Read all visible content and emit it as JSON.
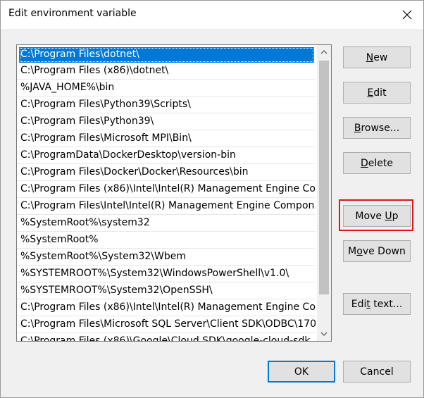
{
  "window": {
    "title": "Edit environment variable"
  },
  "list": {
    "selected_index": 0,
    "items": [
      "C:\\Program Files\\dotnet\\",
      "C:\\Program Files (x86)\\dotnet\\",
      "%JAVA_HOME%\\bin",
      "C:\\Program Files\\Python39\\Scripts\\",
      "C:\\Program Files\\Python39\\",
      "C:\\Program Files\\Microsoft MPI\\Bin\\",
      "C:\\ProgramData\\DockerDesktop\\version-bin",
      "C:\\Program Files\\Docker\\Docker\\Resources\\bin",
      "C:\\Program Files (x86)\\Intel\\Intel(R) Management Engine Co...",
      "C:\\Program Files\\Intel\\Intel(R) Management Engine Compon...",
      "%SystemRoot%\\system32",
      "%SystemRoot%",
      "%SystemRoot%\\System32\\Wbem",
      "%SYSTEMROOT%\\System32\\WindowsPowerShell\\v1.0\\",
      "%SYSTEMROOT%\\System32\\OpenSSH\\",
      "C:\\Program Files (x86)\\Intel\\Intel(R) Management Engine Co...",
      "C:\\Program Files\\Microsoft SQL Server\\Client SDK\\ODBC\\170...",
      "C:\\Program Files (x86)\\Google\\Cloud SDK\\google-cloud-sdk..."
    ]
  },
  "buttons": {
    "new": {
      "label": "New",
      "access": "N"
    },
    "edit": {
      "label": "Edit",
      "access": "E"
    },
    "browse": {
      "label": "Browse...",
      "access": "B"
    },
    "delete": {
      "label": "Delete",
      "access": "D"
    },
    "move_up": {
      "label": "Move Up",
      "access": "U"
    },
    "move_down": {
      "label": "Move Down",
      "access": "o"
    },
    "edit_text": {
      "label": "Edit text...",
      "access": "t"
    },
    "ok": {
      "label": "OK"
    },
    "cancel": {
      "label": "Cancel"
    }
  },
  "colors": {
    "selection": "#0078d7",
    "highlight_box": "#e0141b",
    "dialog_bg": "#f0f0f0"
  }
}
